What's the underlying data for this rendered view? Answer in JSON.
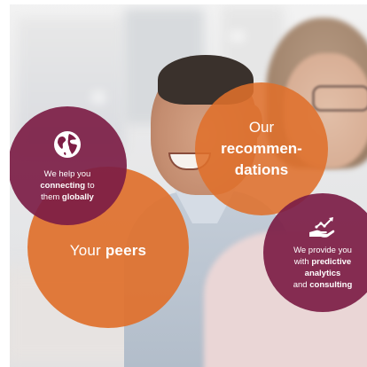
{
  "circles": {
    "global": {
      "icon": "globe-icon",
      "line1": "We help you",
      "line2_bold": "connecting",
      "line2_rest": " to",
      "line3_rest": "them ",
      "line3_bold": "globally",
      "color": "#7c1d45"
    },
    "peers": {
      "text_regular": "Your ",
      "text_bold": "peers",
      "color": "#df702b"
    },
    "recommendations": {
      "line1": "Our",
      "line2": "recommen-",
      "line3": "dations",
      "color": "#df702b"
    },
    "analytics": {
      "icon": "hand-chart-icon",
      "line1": "We provide you",
      "line2_rest": "with ",
      "line2_bold": "predictive",
      "line3_bold": "analytics",
      "line4_rest": "and ",
      "line4_bold": "consulting",
      "color": "#7c1d45"
    }
  }
}
